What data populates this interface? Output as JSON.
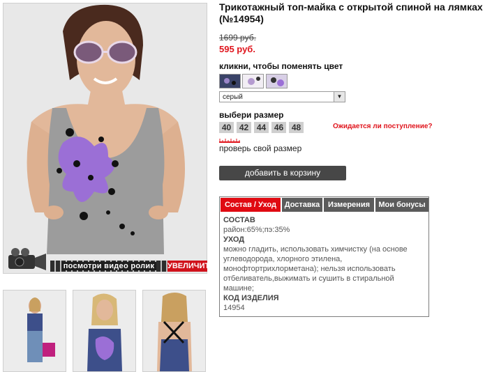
{
  "product": {
    "title": "Трикотажный топ-майка с открытой спиной на лямках (№14954)",
    "old_price": "1699 руб.",
    "new_price": "595 руб."
  },
  "media": {
    "video_label": "посмотри видео ролик",
    "zoom_label": "УВЕЛИЧИТЬ"
  },
  "color": {
    "label": "кликни, чтобы поменять цвет",
    "swatches": [
      "dark-blue",
      "white-floral",
      "lilac-print"
    ],
    "selected": "серый"
  },
  "size": {
    "label": "выбери размер",
    "options": [
      "40",
      "42",
      "44",
      "46",
      "48"
    ],
    "expect_link": "Ожидается ли поступление?",
    "check_link": "проверь свой размер"
  },
  "cart": {
    "button_label": "добавить в корзину"
  },
  "tabs": {
    "items": [
      "Состав / Уход",
      "Доставка",
      "Измерения",
      "Мои бонусы"
    ],
    "active": 0,
    "content": {
      "composition_heading": "СОСТАВ",
      "composition_value": "район:65%;пэ:35%",
      "care_heading": "УХОД",
      "care_text": "можно гладить, использовать химчистку (на основе углеводорода, хлорного этилена, монофтортрихлорметана); нельзя использовать отбеливатель,выжимать и сушить в стиральной машине;",
      "code_heading": "КОД ИЗДЕЛИЯ",
      "code_value": "14954"
    }
  },
  "colors": {
    "accent_red": "#e0141c",
    "button_dark": "#474747",
    "tab_grey": "#5b5b5b"
  }
}
